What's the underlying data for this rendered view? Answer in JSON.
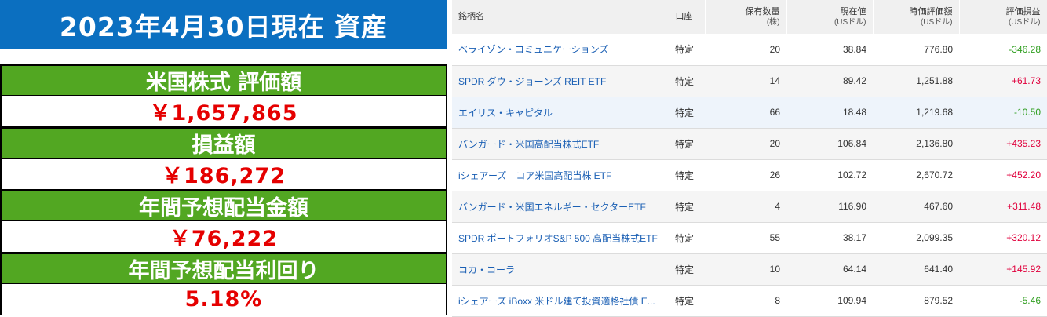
{
  "summary": {
    "title": "2023年4月30日現在 資産",
    "us_stock_label": "米国株式 評価額",
    "us_stock_value": "￥1,657,865",
    "pl_label": "損益額",
    "pl_value": "￥186,272",
    "dividend_label": "年間予想配当金額",
    "dividend_value": "￥76,222",
    "yield_label": "年間予想配当利回り",
    "yield_value": "5.18%"
  },
  "colors": {
    "title_bg": "#0b6fc0",
    "label_bg": "#52a722",
    "value_text": "#e50000",
    "positive": "#e0003c",
    "negative": "#2f9e1f",
    "link": "#1a5fb4"
  },
  "table": {
    "headers": {
      "name": "銘柄名",
      "account": "口座",
      "qty": "保有数量",
      "qty_unit": "(株)",
      "price": "現在値",
      "price_unit": "(USドル)",
      "value": "時価評価額",
      "value_unit": "(USドル)",
      "pl": "評価損益",
      "pl_unit": "(USドル)"
    },
    "rows": [
      {
        "name": "ベライゾン・コミュニケーションズ",
        "account": "特定",
        "qty": "20",
        "price": "38.84",
        "value": "776.80",
        "pl": "-346.28"
      },
      {
        "name": "SPDR ダウ・ジョーンズ REIT ETF",
        "account": "特定",
        "qty": "14",
        "price": "89.42",
        "value": "1,251.88",
        "pl": "+61.73"
      },
      {
        "name": "エイリス・キャピタル",
        "account": "特定",
        "qty": "66",
        "price": "18.48",
        "value": "1,219.68",
        "pl": "-10.50"
      },
      {
        "name": "バンガード・米国高配当株式ETF",
        "account": "特定",
        "qty": "20",
        "price": "106.84",
        "value": "2,136.80",
        "pl": "+435.23"
      },
      {
        "name": "iシェアーズ　コア米国高配当株 ETF",
        "account": "特定",
        "qty": "26",
        "price": "102.72",
        "value": "2,670.72",
        "pl": "+452.20"
      },
      {
        "name": "バンガード・米国エネルギー・セクターETF",
        "account": "特定",
        "qty": "4",
        "price": "116.90",
        "value": "467.60",
        "pl": "+311.48"
      },
      {
        "name": "SPDR ポートフォリオS&P 500 高配当株式ETF",
        "account": "特定",
        "qty": "55",
        "price": "38.17",
        "value": "2,099.35",
        "pl": "+320.12"
      },
      {
        "name": "コカ・コーラ",
        "account": "特定",
        "qty": "10",
        "price": "64.14",
        "value": "641.40",
        "pl": "+145.92"
      },
      {
        "name": "iシェアーズ iBoxx 米ドル建て投資適格社債 E...",
        "account": "特定",
        "qty": "8",
        "price": "109.94",
        "value": "879.52",
        "pl": "-5.46"
      }
    ]
  }
}
